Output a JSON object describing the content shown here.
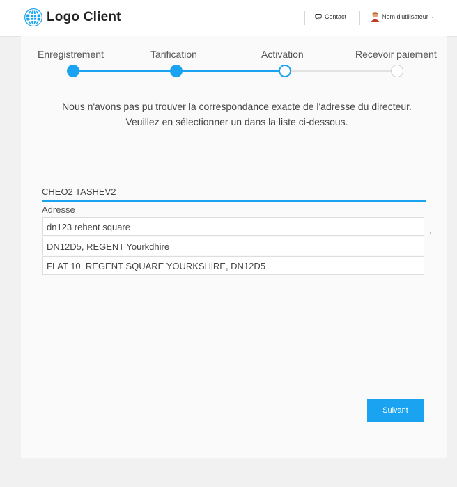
{
  "header": {
    "logo_text": "Logo Client",
    "contact_label": "Contact",
    "user_label": "Nom d'utilisateur",
    "logo_icon": "globe-icon",
    "contact_icon": "chat-bubble-icon",
    "caret_icon": "chevron-down-icon"
  },
  "steps": [
    {
      "label": "Enregistrement",
      "status": "done"
    },
    {
      "label": "Tarification",
      "status": "done"
    },
    {
      "label": "Activation",
      "status": "current"
    },
    {
      "label": "Recevoir paiement",
      "status": "todo"
    }
  ],
  "message": {
    "line1": "Nous n'avons pas pu trouver la correspondance exacte de l'adresse du directeur.",
    "line2": "Veuillez en sélectionner un dans la liste ci-dessous."
  },
  "director_name": "CHEO2 TASHEV2",
  "address": {
    "label": "Adresse",
    "options": [
      "dn123 rehent square",
      "DN12D5, REGENT  Yourkdhire",
      "FLAT 10, REGENT SQUARE YOURKSHiRE, DN12D5"
    ]
  },
  "next_button": "Suivant",
  "colors": {
    "accent": "#1aa3f0",
    "background": "#f1f1f1",
    "panel": "#fafafa"
  }
}
